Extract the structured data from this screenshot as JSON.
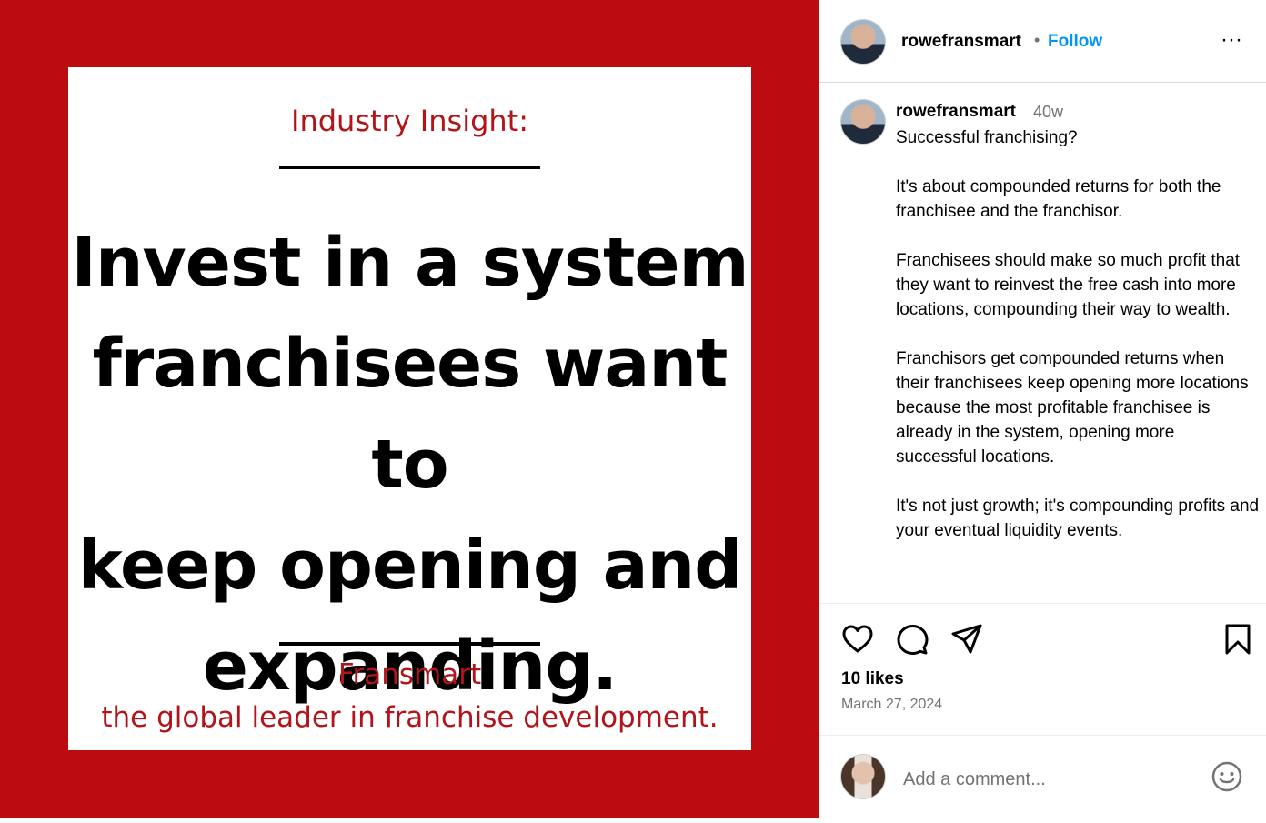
{
  "image": {
    "kicker": "Industry Insight:",
    "headline_lines": [
      "Invest in a system",
      "franchisees want to",
      "keep opening and",
      "expanding."
    ],
    "brand": "Fransmart",
    "tagline": "the global leader in franchise development.",
    "background_color": "#bb0c10",
    "accent_color": "#b2141a"
  },
  "header": {
    "username": "rowefransmart",
    "separator": "•",
    "follow_label": "Follow",
    "more_icon": "more-horizontal-icon",
    "more_glyph": "···"
  },
  "caption": {
    "username": "rowefransmart",
    "time": "40w",
    "text": "Successful franchising?\n\nIt's about compounded returns for both the franchisee and the franchisor.\n\nFranchisees should make so much profit that they want to reinvest the free cash into more locations, compounding their way to wealth.\n\nFranchisors get compounded returns when their franchisees keep opening more locations because the most profitable franchisee is already in the system, opening more successful locations.\n\nIt's not just growth; it's compounding profits and your eventual liquidity events."
  },
  "actions": {
    "icons": [
      "heart-icon",
      "comment-icon",
      "share-icon",
      "bookmark-icon"
    ],
    "likes": "10 likes",
    "date": "March 27, 2024"
  },
  "comment": {
    "placeholder": "Add a comment...",
    "emoji_icon": "emoji-icon"
  },
  "colors": {
    "link_blue": "#0095f6",
    "muted_gray": "#737373"
  }
}
